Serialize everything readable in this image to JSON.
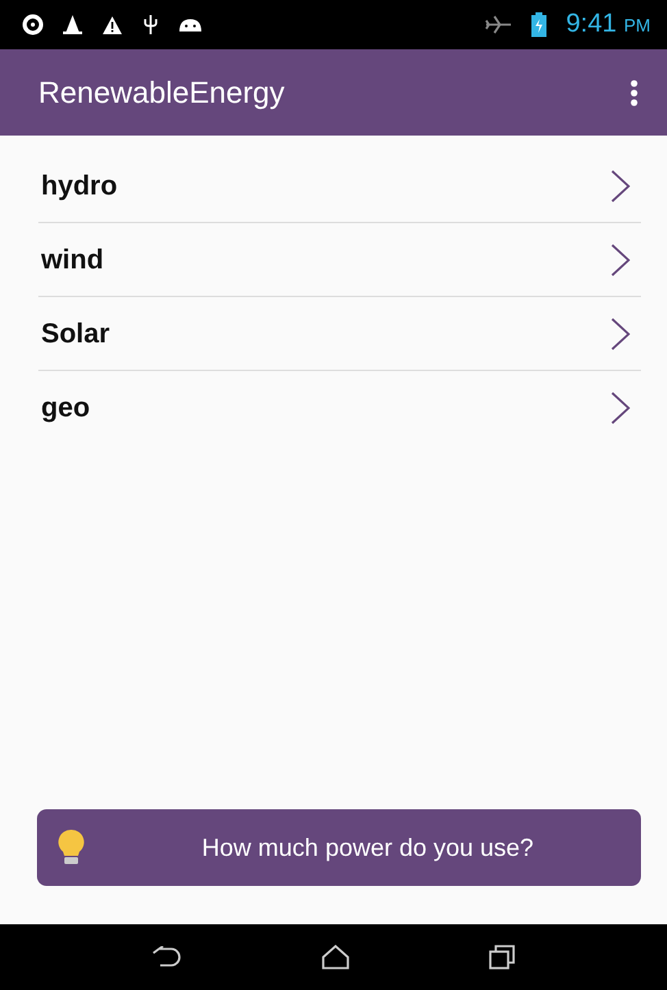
{
  "status_bar": {
    "time": "9:41",
    "meridiem": "PM"
  },
  "app_bar": {
    "title": "RenewableEnergy"
  },
  "items": [
    {
      "label": "hydro"
    },
    {
      "label": "wind"
    },
    {
      "label": "Solar"
    },
    {
      "label": "geo"
    }
  ],
  "action_button": {
    "label": "How much power do you use?"
  }
}
